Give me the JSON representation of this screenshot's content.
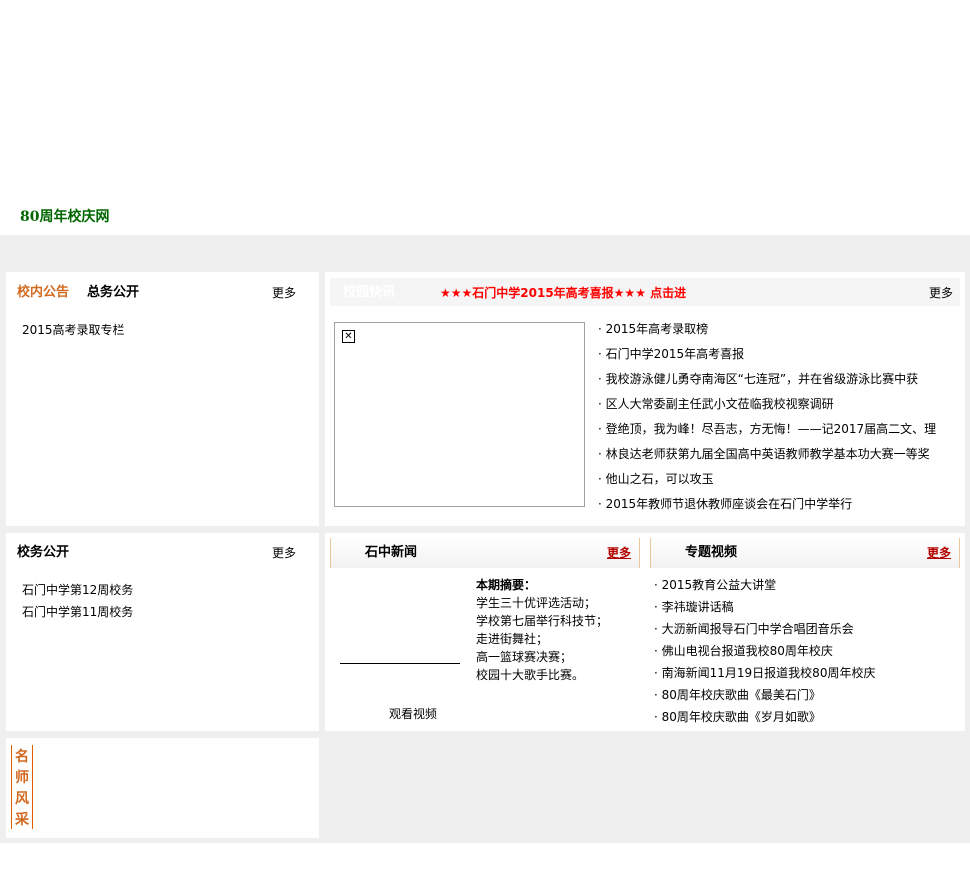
{
  "site_link": "80周年校庆网",
  "notice": {
    "tab_active": "校内公告",
    "tab_other": "总务公开",
    "more": "更多",
    "items": [
      "2015高考录取专栏"
    ]
  },
  "campus": {
    "tab_label": "校园快讯",
    "banner": "★★★石门中学2015年高考喜报★★★  点击进",
    "more": "更多",
    "items": [
      "2015年高考录取榜",
      "石门中学2015年高考喜报",
      "我校游泳健儿勇夺南海区“七连冠”，并在省级游泳比赛中获",
      "区人大常委副主任武小文莅临我校视察调研",
      "登绝顶，我为峰！尽吾志，方无悔！——记2017届高二文、理",
      "林良达老师获第九届全国高中英语教师教学基本功大赛一等奖",
      "他山之石，可以攻玉",
      "2015年教师节退休教师座谈会在石门中学举行"
    ]
  },
  "affairs": {
    "title": "校务公开",
    "more": "更多",
    "items": [
      "石门中学第12周校务",
      "石门中学第11周校务"
    ]
  },
  "news": {
    "title": "石中新闻",
    "more": "更多",
    "summary_title": "本期摘要：",
    "summary_lines": [
      "学生三十优评选活动；",
      "学校第七届举行科技节；",
      "走进街舞社；",
      "高一篮球赛决赛；",
      "校园十大歌手比赛。"
    ],
    "watch_video": "观看视频"
  },
  "videos": {
    "title": "专题视频",
    "more": "更多",
    "items": [
      "2015教育公益大讲堂",
      "李祎璇讲话稿",
      "大沥新闻报导石门中学合唱团音乐会",
      "佛山电视台报道我校80周年校庆",
      "南海新闻11月19日报道我校80周年校庆",
      "80周年校庆歌曲《最美石门》",
      "80周年校庆歌曲《岁月如歌》"
    ]
  },
  "teachers": {
    "title_chars": [
      "名",
      "师",
      "风",
      "采"
    ]
  },
  "colors": {
    "link_green": "#006600",
    "accent_orange": "#d2691e",
    "banner_red": "#ff0000",
    "more_red": "#b30000",
    "background_grey": "#efefef"
  }
}
